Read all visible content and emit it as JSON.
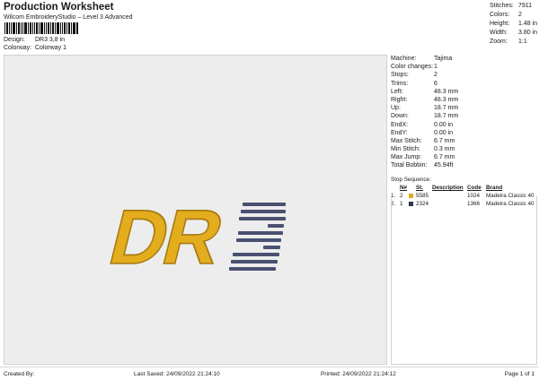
{
  "header": {
    "title": "Production Worksheet",
    "subtitle": "Wilcom EmbroideryStudio – Level 3 Advanced",
    "design_label": "Design:",
    "design_value": "DR3 3,8 in",
    "colorway_label": "Colorway:",
    "colorway_value": "Colorway 1"
  },
  "summary": [
    {
      "label": "Stitches:",
      "value": "7911"
    },
    {
      "label": "Colors:",
      "value": "2"
    },
    {
      "label": "Height:",
      "value": "1.48 in"
    },
    {
      "label": "Width:",
      "value": "3.80 in"
    },
    {
      "label": "Zoom:",
      "value": "1:1"
    }
  ],
  "preview": {
    "text": "DR",
    "digit": "3",
    "colors": {
      "gold": "#e6b020",
      "gold_dark": "#a67a10",
      "navy": "#4a5070",
      "background": "#ededed"
    }
  },
  "details": [
    {
      "label": "Machine:",
      "value": "Tajima"
    },
    {
      "label": "Color changes:",
      "value": "1"
    },
    {
      "label": "Stops:",
      "value": "2"
    },
    {
      "label": "Trims:",
      "value": "6"
    },
    {
      "label": "Left:",
      "value": "48.3 mm"
    },
    {
      "label": "Right:",
      "value": "48.3 mm"
    },
    {
      "label": "Up:",
      "value": "18.7 mm"
    },
    {
      "label": "Down:",
      "value": "18.7 mm"
    },
    {
      "label": "EndX:",
      "value": "0.00 in"
    },
    {
      "label": "EndY:",
      "value": "0.00 in"
    },
    {
      "label": "Max Stitch:",
      "value": "6.7 mm"
    },
    {
      "label": "Min Stitch:",
      "value": "0.3 mm"
    },
    {
      "label": "Max Jump:",
      "value": "6.7 mm"
    },
    {
      "label": "Total Bobbin:",
      "value": "45.94ft"
    }
  ],
  "stop_sequence": {
    "title": "Stop Sequence:",
    "headers": {
      "n": "N#",
      "st": "St.",
      "description": "Description",
      "code": "Code",
      "brand": "Brand"
    },
    "rows": [
      {
        "order": "1.",
        "n": "2",
        "color": "#e6a81e",
        "st": "5585",
        "description": "",
        "code": "1024",
        "brand": "Madeira Classic 40"
      },
      {
        "order": "2.",
        "n": "1",
        "color": "#2c3656",
        "st": "2324",
        "description": "",
        "code": "1366",
        "brand": "Madeira Classic 40"
      }
    ]
  },
  "footer": {
    "created_by": "Created By:",
    "last_saved": "Last Saved: 24/09/2022 21:24:10",
    "printed": "Printed: 24/09/2022 21:24:12",
    "page": "Page 1 of 1"
  }
}
